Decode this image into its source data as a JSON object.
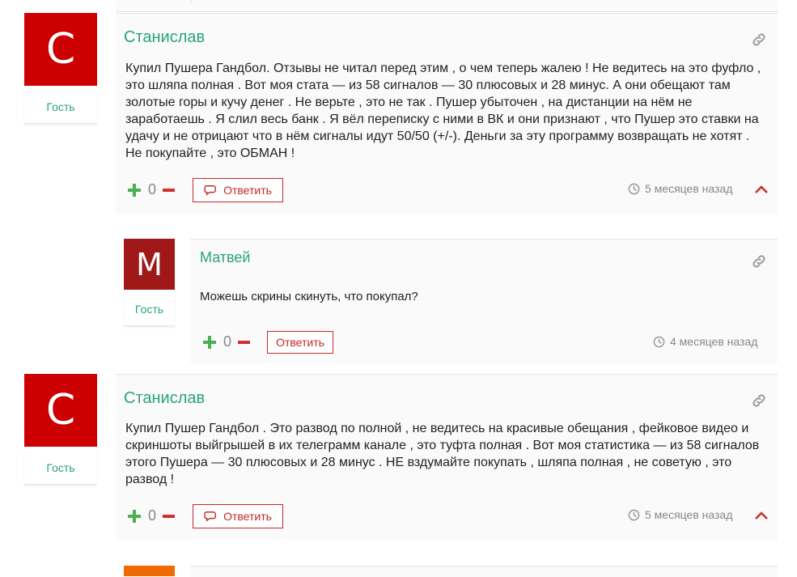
{
  "colors": {
    "name_green": "#2aa37a",
    "role_green": "#2aa37a",
    "avatar_red": "#cc0000",
    "avatar_darkred": "#a01818",
    "avatar_orange": "#f06a00"
  },
  "comments": [
    {
      "avatar_letter": "С",
      "role": "Гость",
      "author": "Станислав",
      "text": "Купил Пушера Гандбол. Отзывы не читал перед этим , о чем теперь жалею ! Не ведитесь на это фуфло , это шляпа полная . Вот моя стата — из 58 сигналов — 30 плюсовых и 28 минус. А они обещают там золотые горы и кучу денег . Не верьте , это не так . Пушер убыточен , на дистанции на нём не заработаешь . Я слил весь банк . Я вёл переписку с ними в ВК и они признают , что Пушер это ставки на удачу и не отрицают что в нём сигналы идут 50/50 (+/-). Деньги за эту программу возвращать не хотят . Не покупайте , это ОБМАН !",
      "votes": "0",
      "reply_label": "Ответить",
      "time": "5 месяцев назад"
    },
    {
      "avatar_letter": "М",
      "role": "Гость",
      "author": "Матвей",
      "text": "Можешь скрины скинуть, что покупал?",
      "votes": "0",
      "reply_label": "Ответить",
      "time": "4 месяцев назад"
    },
    {
      "avatar_letter": "С",
      "role": "Гость",
      "author": "Станислав",
      "text": "Купил Пушер Гандбол . Это развод по полной , не ведитесь на красивые обещания , фейковое видео и скриншоты выйгрышей в их телеграмм канале , это туфта полная . Вот моя статистика — из 58 сигналов этого Пушера — 30 плюсовых и 28 минус . НЕ вздумайте покупать , шляпа полная , не советую , это развод !",
      "votes": "0",
      "reply_label": "Ответить",
      "time": "5 месяцев назад"
    }
  ]
}
